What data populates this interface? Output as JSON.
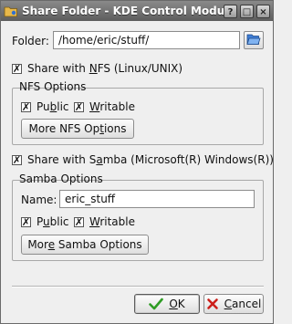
{
  "window": {
    "title": "Share Folder - KDE Control Module"
  },
  "titlebar_buttons": {
    "help": "?",
    "maximize": "□",
    "close": "×"
  },
  "folder": {
    "label": "Folder:",
    "path": "/home/eric/stuff/"
  },
  "nfs": {
    "share_checked": true,
    "share_label_pre": "Share with ",
    "share_label_key": "N",
    "share_label_post": "FS (Linux/UNIX)",
    "group_title": "NFS Options",
    "public_checked": true,
    "public_pre": "Pu",
    "public_key": "b",
    "public_post": "lic",
    "writable_checked": true,
    "writable_key": "W",
    "writable_post": "ritable",
    "more_pre": "More NFS Op",
    "more_key": "t",
    "more_post": "ions"
  },
  "samba": {
    "share_checked": true,
    "share_label_pre": "Share with S",
    "share_label_key": "a",
    "share_label_post": "mba (Microsoft(R) Windows(R))",
    "group_title": "Samba Options",
    "name_label": "Name:",
    "name_value": "eric_stuff",
    "public_checked": true,
    "public_pre": "P",
    "public_key": "u",
    "public_post": "blic",
    "writable_checked": true,
    "writable_key": "W",
    "writable_post": "ritable",
    "more_pre": "Mor",
    "more_key": "e",
    "more_post": " Samba Options"
  },
  "buttons": {
    "ok_key": "O",
    "ok_post": "K",
    "cancel_key": "C",
    "cancel_post": "ancel"
  },
  "icons": {
    "app": "share-folder-icon",
    "browse": "folder-open-icon",
    "ok": "checkmark-icon",
    "cancel": "cancel-icon",
    "check_glyph": "✗"
  },
  "colors": {
    "titlebar": "#6f6f6f",
    "window_bg": "#efefef",
    "ok_check": "#2e9c24",
    "cancel_x": "#cc1f1a"
  }
}
